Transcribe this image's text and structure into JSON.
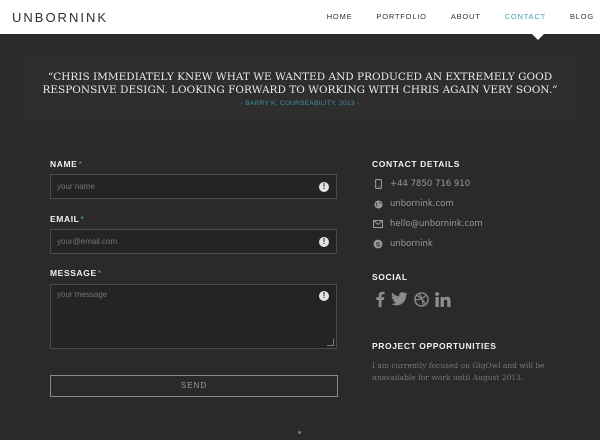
{
  "header": {
    "logo": "UNBORNINK",
    "nav": [
      {
        "label": "HOME",
        "active": false
      },
      {
        "label": "PORTFOLIO",
        "active": false
      },
      {
        "label": "ABOUT",
        "active": false
      },
      {
        "label": "CONTACT",
        "active": true
      },
      {
        "label": "BLOG",
        "active": false
      }
    ]
  },
  "testimonial": {
    "line1": "“CHRIS IMMEDIATELY KNEW WHAT WE WANTED AND PRODUCED AN EXTREMELY GOOD",
    "line2": "RESPONSIVE DESIGN. LOOKING FORWARD TO WORKING WITH CHRIS AGAIN VERY SOON.”",
    "author": "- BARRY K, COURSEABILITY, 2013 -"
  },
  "form": {
    "name_label": "NAME",
    "name_placeholder": "your name",
    "email_label": "EMAIL",
    "email_placeholder": "your@email.com",
    "message_label": "MESSAGE",
    "message_placeholder": "your message",
    "required_mark": "*",
    "alert_glyph": "!",
    "send_label": "SEND"
  },
  "contact": {
    "title": "CONTACT DETAILS",
    "phone": "+44 7850 716 910",
    "website": "unbornink.com",
    "email": "hello@unbornink.com",
    "skype": "unbornink"
  },
  "social": {
    "title": "SOCIAL",
    "icons": [
      "facebook-icon",
      "twitter-icon",
      "dribbble-icon",
      "linkedin-icon"
    ]
  },
  "opportunities": {
    "title": "PROJECT OPPORTUNITIES",
    "text": "I am currently focused on GigOwl and will be unavailable for work until August 2013."
  },
  "colors": {
    "accent": "#4a9fb7",
    "background": "#2a2a2a",
    "header_bg": "#ffffff"
  }
}
